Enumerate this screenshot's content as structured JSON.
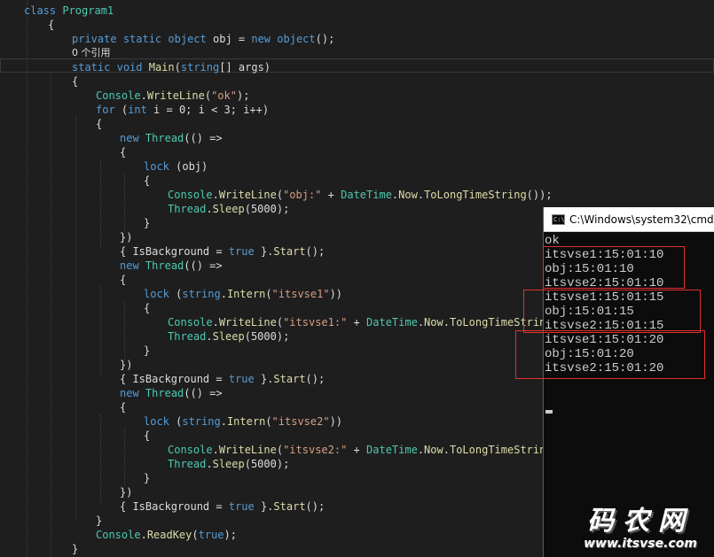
{
  "editor": {
    "lines": [
      {
        "kind": "code",
        "indent": 0,
        "spans": [
          {
            "c": "kw",
            "t": "class"
          },
          {
            "c": "pl",
            "t": " "
          },
          {
            "c": "ty",
            "t": "Program1"
          }
        ]
      },
      {
        "kind": "code",
        "indent": 1,
        "spans": [
          {
            "c": "pl",
            "t": "{"
          }
        ]
      },
      {
        "kind": "code",
        "indent": 2,
        "spans": [
          {
            "c": "kw",
            "t": "private"
          },
          {
            "c": "pl",
            "t": " "
          },
          {
            "c": "kw",
            "t": "static"
          },
          {
            "c": "pl",
            "t": " "
          },
          {
            "c": "kw",
            "t": "object"
          },
          {
            "c": "pl",
            "t": " obj = "
          },
          {
            "c": "kw",
            "t": "new"
          },
          {
            "c": "pl",
            "t": " "
          },
          {
            "c": "kw",
            "t": "object"
          },
          {
            "c": "pl",
            "t": "();"
          }
        ]
      },
      {
        "kind": "codelens",
        "indent": 2,
        "spans": [
          {
            "c": "pl",
            "t": "0 个引用"
          }
        ]
      },
      {
        "kind": "code",
        "indent": 2,
        "spans": [
          {
            "c": "kw",
            "t": "static"
          },
          {
            "c": "pl",
            "t": " "
          },
          {
            "c": "kw",
            "t": "void"
          },
          {
            "c": "pl",
            "t": " "
          },
          {
            "c": "fn",
            "t": "Main"
          },
          {
            "c": "pl",
            "t": "("
          },
          {
            "c": "kw",
            "t": "string"
          },
          {
            "c": "pl",
            "t": "[] args)"
          }
        ]
      },
      {
        "kind": "code",
        "indent": 2,
        "spans": [
          {
            "c": "pl",
            "t": "{"
          }
        ]
      },
      {
        "kind": "code",
        "indent": 3,
        "spans": [
          {
            "c": "ty",
            "t": "Console"
          },
          {
            "c": "pl",
            "t": "."
          },
          {
            "c": "fn",
            "t": "WriteLine"
          },
          {
            "c": "pl",
            "t": "("
          },
          {
            "c": "str",
            "t": "\"ok\""
          },
          {
            "c": "pl",
            "t": ");"
          }
        ]
      },
      {
        "kind": "code",
        "indent": 3,
        "spans": [
          {
            "c": "kw",
            "t": "for"
          },
          {
            "c": "pl",
            "t": " ("
          },
          {
            "c": "kw",
            "t": "int"
          },
          {
            "c": "pl",
            "t": " i = 0; i < 3; i++)"
          }
        ]
      },
      {
        "kind": "code",
        "indent": 3,
        "spans": [
          {
            "c": "pl",
            "t": "{"
          }
        ]
      },
      {
        "kind": "code",
        "indent": 4,
        "spans": [
          {
            "c": "kw",
            "t": "new"
          },
          {
            "c": "pl",
            "t": " "
          },
          {
            "c": "ty",
            "t": "Thread"
          },
          {
            "c": "pl",
            "t": "(() =>"
          }
        ]
      },
      {
        "kind": "code",
        "indent": 4,
        "spans": [
          {
            "c": "pl",
            "t": "{"
          }
        ]
      },
      {
        "kind": "code",
        "indent": 5,
        "spans": [
          {
            "c": "kw",
            "t": "lock"
          },
          {
            "c": "pl",
            "t": " (obj)"
          }
        ]
      },
      {
        "kind": "code",
        "indent": 5,
        "spans": [
          {
            "c": "pl",
            "t": "{"
          }
        ]
      },
      {
        "kind": "code",
        "indent": 6,
        "spans": [
          {
            "c": "ty",
            "t": "Console"
          },
          {
            "c": "pl",
            "t": "."
          },
          {
            "c": "fn",
            "t": "WriteLine"
          },
          {
            "c": "pl",
            "t": "("
          },
          {
            "c": "str",
            "t": "\"obj:\""
          },
          {
            "c": "pl",
            "t": " + "
          },
          {
            "c": "ty",
            "t": "DateTime"
          },
          {
            "c": "pl",
            "t": "."
          },
          {
            "c": "fn",
            "t": "Now"
          },
          {
            "c": "pl",
            "t": "."
          },
          {
            "c": "fn",
            "t": "ToLongTimeString"
          },
          {
            "c": "pl",
            "t": "());"
          }
        ]
      },
      {
        "kind": "code",
        "indent": 6,
        "spans": [
          {
            "c": "ty",
            "t": "Thread"
          },
          {
            "c": "pl",
            "t": "."
          },
          {
            "c": "fn",
            "t": "Sleep"
          },
          {
            "c": "pl",
            "t": "(5000);"
          }
        ]
      },
      {
        "kind": "code",
        "indent": 5,
        "spans": [
          {
            "c": "pl",
            "t": "}"
          }
        ]
      },
      {
        "kind": "code",
        "indent": 4,
        "spans": [
          {
            "c": "pl",
            "t": "})"
          }
        ]
      },
      {
        "kind": "code",
        "indent": 4,
        "spans": [
          {
            "c": "pl",
            "t": "{ IsBackground = "
          },
          {
            "c": "kw",
            "t": "true"
          },
          {
            "c": "pl",
            "t": " }."
          },
          {
            "c": "fn",
            "t": "Start"
          },
          {
            "c": "pl",
            "t": "();"
          }
        ]
      },
      {
        "kind": "code",
        "indent": 4,
        "spans": [
          {
            "c": "kw",
            "t": "new"
          },
          {
            "c": "pl",
            "t": " "
          },
          {
            "c": "ty",
            "t": "Thread"
          },
          {
            "c": "pl",
            "t": "(() =>"
          }
        ]
      },
      {
        "kind": "code",
        "indent": 4,
        "spans": [
          {
            "c": "pl",
            "t": "{"
          }
        ]
      },
      {
        "kind": "code",
        "indent": 5,
        "spans": [
          {
            "c": "kw",
            "t": "lock"
          },
          {
            "c": "pl",
            "t": " ("
          },
          {
            "c": "kw",
            "t": "string"
          },
          {
            "c": "pl",
            "t": "."
          },
          {
            "c": "fn",
            "t": "Intern"
          },
          {
            "c": "pl",
            "t": "("
          },
          {
            "c": "str",
            "t": "\"itsvse1\""
          },
          {
            "c": "pl",
            "t": "))"
          }
        ]
      },
      {
        "kind": "code",
        "indent": 5,
        "spans": [
          {
            "c": "pl",
            "t": "{"
          }
        ]
      },
      {
        "kind": "code",
        "indent": 6,
        "spans": [
          {
            "c": "ty",
            "t": "Console"
          },
          {
            "c": "pl",
            "t": "."
          },
          {
            "c": "fn",
            "t": "WriteLine"
          },
          {
            "c": "pl",
            "t": "("
          },
          {
            "c": "str",
            "t": "\"itsvse1:\""
          },
          {
            "c": "pl",
            "t": " + "
          },
          {
            "c": "ty",
            "t": "DateTime"
          },
          {
            "c": "pl",
            "t": "."
          },
          {
            "c": "fn",
            "t": "Now"
          },
          {
            "c": "pl",
            "t": "."
          },
          {
            "c": "fn",
            "t": "ToLongTimeString"
          },
          {
            "c": "pl",
            "t": "());"
          }
        ]
      },
      {
        "kind": "code",
        "indent": 6,
        "spans": [
          {
            "c": "ty",
            "t": "Thread"
          },
          {
            "c": "pl",
            "t": "."
          },
          {
            "c": "fn",
            "t": "Sleep"
          },
          {
            "c": "pl",
            "t": "(5000);"
          }
        ]
      },
      {
        "kind": "code",
        "indent": 5,
        "spans": [
          {
            "c": "pl",
            "t": "}"
          }
        ]
      },
      {
        "kind": "code",
        "indent": 4,
        "spans": [
          {
            "c": "pl",
            "t": "})"
          }
        ]
      },
      {
        "kind": "code",
        "indent": 4,
        "spans": [
          {
            "c": "pl",
            "t": "{ IsBackground = "
          },
          {
            "c": "kw",
            "t": "true"
          },
          {
            "c": "pl",
            "t": " }."
          },
          {
            "c": "fn",
            "t": "Start"
          },
          {
            "c": "pl",
            "t": "();"
          }
        ]
      },
      {
        "kind": "code",
        "indent": 4,
        "spans": [
          {
            "c": "kw",
            "t": "new"
          },
          {
            "c": "pl",
            "t": " "
          },
          {
            "c": "ty",
            "t": "Thread"
          },
          {
            "c": "pl",
            "t": "(() =>"
          }
        ]
      },
      {
        "kind": "code",
        "indent": 4,
        "spans": [
          {
            "c": "pl",
            "t": "{"
          }
        ]
      },
      {
        "kind": "code",
        "indent": 5,
        "spans": [
          {
            "c": "kw",
            "t": "lock"
          },
          {
            "c": "pl",
            "t": " ("
          },
          {
            "c": "kw",
            "t": "string"
          },
          {
            "c": "pl",
            "t": "."
          },
          {
            "c": "fn",
            "t": "Intern"
          },
          {
            "c": "pl",
            "t": "("
          },
          {
            "c": "str",
            "t": "\"itsvse2\""
          },
          {
            "c": "pl",
            "t": "))"
          }
        ]
      },
      {
        "kind": "code",
        "indent": 5,
        "spans": [
          {
            "c": "pl",
            "t": "{"
          }
        ]
      },
      {
        "kind": "code",
        "indent": 6,
        "spans": [
          {
            "c": "ty",
            "t": "Console"
          },
          {
            "c": "pl",
            "t": "."
          },
          {
            "c": "fn",
            "t": "WriteLine"
          },
          {
            "c": "pl",
            "t": "("
          },
          {
            "c": "str",
            "t": "\"itsvse2:\""
          },
          {
            "c": "pl",
            "t": " + "
          },
          {
            "c": "ty",
            "t": "DateTime"
          },
          {
            "c": "pl",
            "t": "."
          },
          {
            "c": "fn",
            "t": "Now"
          },
          {
            "c": "pl",
            "t": "."
          },
          {
            "c": "fn",
            "t": "ToLongTimeString"
          },
          {
            "c": "pl",
            "t": "());"
          }
        ]
      },
      {
        "kind": "code",
        "indent": 6,
        "spans": [
          {
            "c": "ty",
            "t": "Thread"
          },
          {
            "c": "pl",
            "t": "."
          },
          {
            "c": "fn",
            "t": "Sleep"
          },
          {
            "c": "pl",
            "t": "(5000);"
          }
        ]
      },
      {
        "kind": "code",
        "indent": 5,
        "spans": [
          {
            "c": "pl",
            "t": "}"
          }
        ]
      },
      {
        "kind": "code",
        "indent": 4,
        "spans": [
          {
            "c": "pl",
            "t": "})"
          }
        ]
      },
      {
        "kind": "code",
        "indent": 4,
        "spans": [
          {
            "c": "pl",
            "t": "{ IsBackground = "
          },
          {
            "c": "kw",
            "t": "true"
          },
          {
            "c": "pl",
            "t": " }."
          },
          {
            "c": "fn",
            "t": "Start"
          },
          {
            "c": "pl",
            "t": "();"
          }
        ]
      },
      {
        "kind": "code",
        "indent": 3,
        "spans": [
          {
            "c": "pl",
            "t": "}"
          }
        ]
      },
      {
        "kind": "code",
        "indent": 3,
        "spans": [
          {
            "c": "ty",
            "t": "Console"
          },
          {
            "c": "pl",
            "t": "."
          },
          {
            "c": "fn",
            "t": "ReadKey"
          },
          {
            "c": "pl",
            "t": "("
          },
          {
            "c": "kw",
            "t": "true"
          },
          {
            "c": "pl",
            "t": ");"
          }
        ]
      },
      {
        "kind": "code",
        "indent": 2,
        "spans": [
          {
            "c": "pl",
            "t": "}"
          }
        ]
      }
    ]
  },
  "console": {
    "title": "C:\\Windows\\system32\\cmd.exe",
    "icon": "console-window-icon",
    "icon_text": "C:\\",
    "output": [
      "ok",
      "itsvse1:15:01:10",
      "obj:15:01:10",
      "itsvse2:15:01:10",
      "itsvse1:15:01:15",
      "obj:15:01:15",
      "itsvse2:15:01:15",
      "itsvse1:15:01:20",
      "obj:15:01:20",
      "itsvse2:15:01:20"
    ]
  },
  "watermark": {
    "title": "码农网",
    "url": "www.itsvse.com"
  },
  "colors": {
    "editor_bg": "#1e1e1e",
    "keyword": "#569cd6",
    "type": "#4ec9b0",
    "string": "#d69d85",
    "method": "#dcdcaa",
    "plain": "#dcdcdc",
    "console_bg": "#0c0c0c",
    "console_text": "#cccccc",
    "annotation_box": "#e03030"
  }
}
